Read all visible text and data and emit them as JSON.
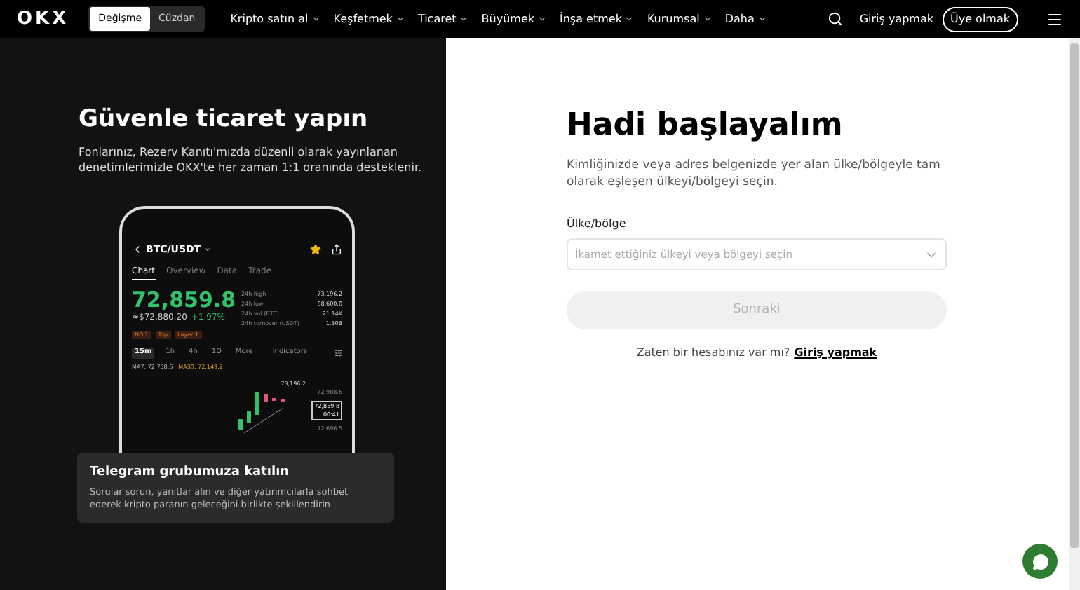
{
  "header": {
    "logo": "OKX",
    "mode_toggle": [
      {
        "label": "Değişme",
        "selected": true
      },
      {
        "label": "Cüzdan",
        "selected": false
      }
    ],
    "nav": [
      "Kripto satın al",
      "Keşfetmek",
      "Ticaret",
      "Büyümek",
      "İnşa etmek",
      "Kurumsal",
      "Daha"
    ],
    "login": "Giriş yapmak",
    "signup": "Üye olmak"
  },
  "promo": {
    "title": "Güvenle ticaret yapın",
    "text": "Fonlarınız, Rezerv Kanıtı'mızda düzenli olarak yayınlanan denetimlerimizle OKX'te her zaman 1:1 oranında desteklenir.",
    "phone": {
      "pair": "BTC/USDT",
      "starred": true,
      "tabs": [
        {
          "label": "Chart",
          "selected": true
        },
        {
          "label": "Overview",
          "selected": false
        },
        {
          "label": "Data",
          "selected": false
        },
        {
          "label": "Trade",
          "selected": false
        }
      ],
      "price": "72,859.8",
      "fiat": "≈$72,880.20",
      "change": "+1.97%",
      "stats": [
        {
          "label": "24h high",
          "value": "73,196.2"
        },
        {
          "label": "24h low",
          "value": "68,600.0"
        },
        {
          "label": "24h vol (BTC)",
          "value": "21.14K"
        },
        {
          "label": "24h turnover (USDT)",
          "value": "1.50B"
        }
      ],
      "tags": [
        "NO.1",
        "Top",
        "Layer 1"
      ],
      "intervals": [
        {
          "label": "15m",
          "selected": true
        },
        {
          "label": "1h",
          "selected": false
        },
        {
          "label": "4h",
          "selected": false
        },
        {
          "label": "1D",
          "selected": false
        },
        {
          "label": "More",
          "selected": false
        }
      ],
      "indicators": "Indicators",
      "ma7": "MA7: 72,758.6",
      "ma30": "MA30: 72,149.2",
      "chart_labels": {
        "high": "73,196.2",
        "level_1": "72,988.6",
        "current": "72,859.8",
        "countdown": "00:41",
        "level_2": "72,696.5"
      }
    },
    "card": {
      "title": "Telegram grubumuza katılın",
      "text": "Sorular sorun, yanıtlar alın ve diğer yatırımcılarla sohbet ederek kripto paranın geleceğini birlikte şekillendirin"
    }
  },
  "signup": {
    "title": "Hadi başlayalım",
    "text": "Kimliğinizde veya adres belgenizde yer alan ülke/bölgeyle tam olarak eşleşen ülkeyi/bölgeyi seçin.",
    "field_label": "Ülke/bölge",
    "placeholder": "İkamet ettiğiniz ülkeyi veya bölgeyi seçin",
    "button": "Sonraki",
    "button_disabled": true,
    "have_account": "Zaten bir hesabınız var mı?",
    "login_link": "Giriş yapmak"
  }
}
